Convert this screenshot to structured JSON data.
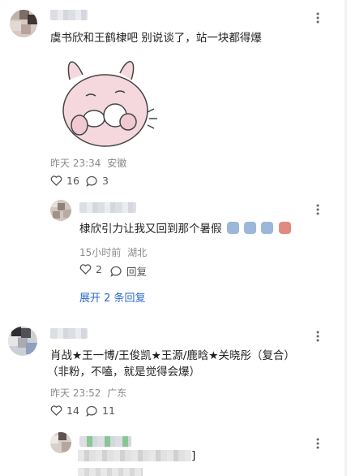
{
  "comments": [
    {
      "text": "虞书欣和王鹤棣吧 别说谈了，站一块都得爆",
      "time": "昨天 23:34",
      "location": "安徽",
      "likes": "16",
      "replies": "3",
      "sticker": "pink-rabbit-sticker"
    },
    {
      "text": "肖战★王一博/王俊凯★王源/鹿晗★关晓彤（复合）",
      "text2": "（非粉，不嗑，就是觉得会爆）",
      "time": "昨天 23:52",
      "location": "广东",
      "likes": "14",
      "replies": "11"
    }
  ],
  "reply": {
    "text": "棣欣引力让我又回到那个暑假",
    "time": "15小时前",
    "location": "湖北",
    "likes": "2",
    "reply_label": "回复"
  },
  "expand_label": "展开 2 条回复",
  "bottom_partial": "]",
  "icons": [
    "more-vertical-icon",
    "heart-icon",
    "comment-icon"
  ],
  "colors": {
    "link": "#2d6cc9",
    "meta": "#8a8a8a",
    "sticker": "#f3d6dd"
  }
}
